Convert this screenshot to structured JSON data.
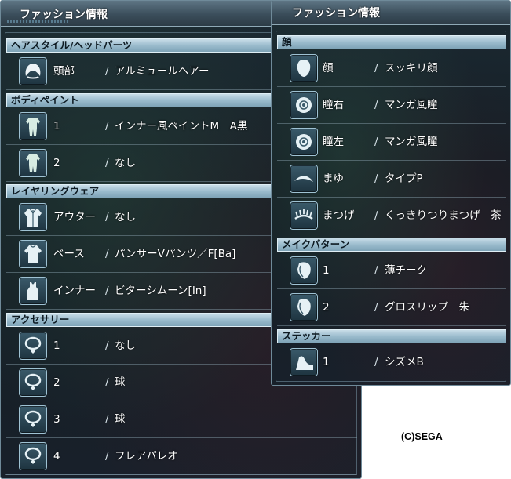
{
  "left_panel": {
    "title": "ファッション情報",
    "sections": {
      "hair": {
        "header": "ヘアスタイル/ヘッドパーツ",
        "rows": [
          {
            "icon": "hair-icon",
            "label": "頭部",
            "value": "アルミュールヘアー"
          }
        ]
      },
      "body_paint": {
        "header": "ボディペイント",
        "rows": [
          {
            "icon": "body-suit-icon",
            "label": "1",
            "value": "インナー風ペイントM　A黒"
          },
          {
            "icon": "body-suit-icon",
            "label": "2",
            "value": "なし"
          }
        ]
      },
      "layering": {
        "header": "レイヤリングウェア",
        "rows": [
          {
            "icon": "jacket-icon",
            "label": "アウター",
            "value": "なし"
          },
          {
            "icon": "shirt-icon",
            "label": "ベース",
            "value": "パンサーVパンツ／F[Ba]"
          },
          {
            "icon": "tank-top-icon",
            "label": "インナー",
            "value": "ビターシムーン[In]"
          }
        ]
      },
      "accessory": {
        "header": "アクセサリー",
        "rows": [
          {
            "icon": "necklace-icon",
            "label": "1",
            "value": "なし"
          },
          {
            "icon": "necklace-icon",
            "label": "2",
            "value": "球"
          },
          {
            "icon": "necklace-icon",
            "label": "3",
            "value": "球"
          },
          {
            "icon": "necklace-icon",
            "label": "4",
            "value": "フレアパレオ"
          }
        ]
      }
    }
  },
  "right_panel": {
    "title": "ファッション情報",
    "sections": {
      "face": {
        "header": "顔",
        "rows": [
          {
            "icon": "face-icon",
            "label": "顔",
            "value": "スッキリ顔"
          },
          {
            "icon": "eye-icon",
            "label": "瞳右",
            "value": "マンガ風瞳"
          },
          {
            "icon": "eye-icon",
            "label": "瞳左",
            "value": "マンガ風瞳"
          },
          {
            "icon": "eyebrow-icon",
            "label": "まゆ",
            "value": "タイプP"
          },
          {
            "icon": "eyelash-icon",
            "label": "まつげ",
            "value": "くっきりつりまつげ　茶"
          }
        ]
      },
      "makeup": {
        "header": "メイクパターン",
        "rows": [
          {
            "icon": "makeup-face-icon",
            "label": "1",
            "value": "薄チーク"
          },
          {
            "icon": "makeup-face-icon",
            "label": "2",
            "value": "グロスリップ　朱"
          }
        ]
      },
      "sticker": {
        "header": "ステッカー",
        "rows": [
          {
            "icon": "sticker-icon",
            "label": "1",
            "value": "シズメB"
          }
        ]
      }
    }
  },
  "separator": "/",
  "copyright": "(C)SEGA",
  "colors": {
    "panel_bg": "#18222b",
    "section_header": "#a9c6d5",
    "icon_border": "#9fc2d3",
    "text": "#ffffff"
  }
}
